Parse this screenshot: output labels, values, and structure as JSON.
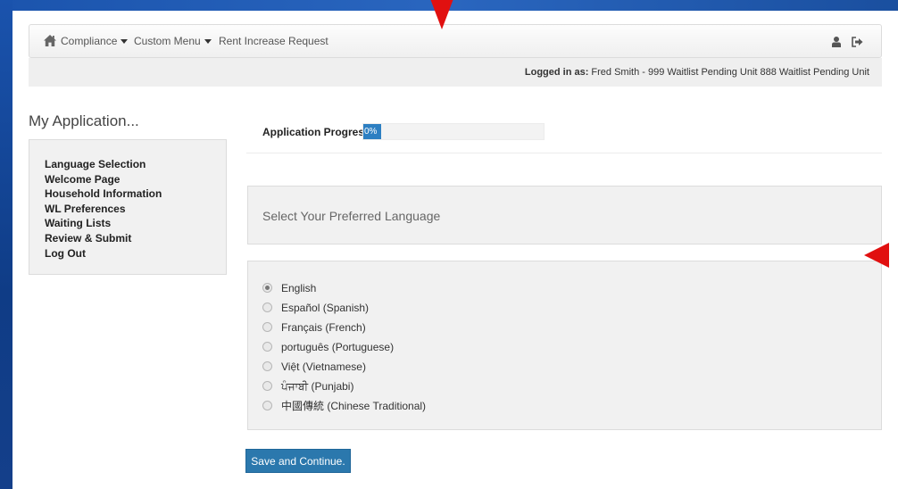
{
  "colors": {
    "accent": "#2b78ad",
    "progress": "#2d7fc2",
    "annotation_arrow": "#e11010",
    "background": "#1c4fa0"
  },
  "navbar": {
    "home_icon": "home-icon",
    "items": [
      {
        "label": "Compliance",
        "dropdown": true
      },
      {
        "label": "Custom Menu",
        "dropdown": true
      },
      {
        "label": "Rent Increase Request",
        "dropdown": false
      }
    ],
    "user_icon": "user-icon",
    "logout_icon": "sign-out-icon"
  },
  "login": {
    "label": "Logged in as:",
    "value": "Fred Smith - 999 Waitlist Pending Unit 888 Waitlist Pending Unit"
  },
  "sidebar": {
    "title": "My Application...",
    "items": [
      {
        "label": "Language Selection"
      },
      {
        "label": "Welcome Page"
      },
      {
        "label": "Household Information"
      },
      {
        "label": "WL Preferences"
      },
      {
        "label": "Waiting Lists"
      },
      {
        "label": "Review & Submit"
      },
      {
        "label": "Log Out"
      }
    ]
  },
  "progress": {
    "label": "Application Progress",
    "value_text": "0%",
    "value": 0
  },
  "language": {
    "header": "Select Your Preferred Language",
    "selected": "English",
    "options": [
      {
        "label": "English",
        "checked": true
      },
      {
        "label": "Español (Spanish)",
        "checked": false
      },
      {
        "label": "Français (French)",
        "checked": false
      },
      {
        "label": "português (Portuguese)",
        "checked": false
      },
      {
        "label": "Việt (Vietnamese)",
        "checked": false
      },
      {
        "label": "ਪੰਜਾਬੀ (Punjabi)",
        "checked": false
      },
      {
        "label": "中國傳統 (Chinese Traditional)",
        "checked": false
      }
    ]
  },
  "actions": {
    "save_label": "Save and Continue."
  }
}
